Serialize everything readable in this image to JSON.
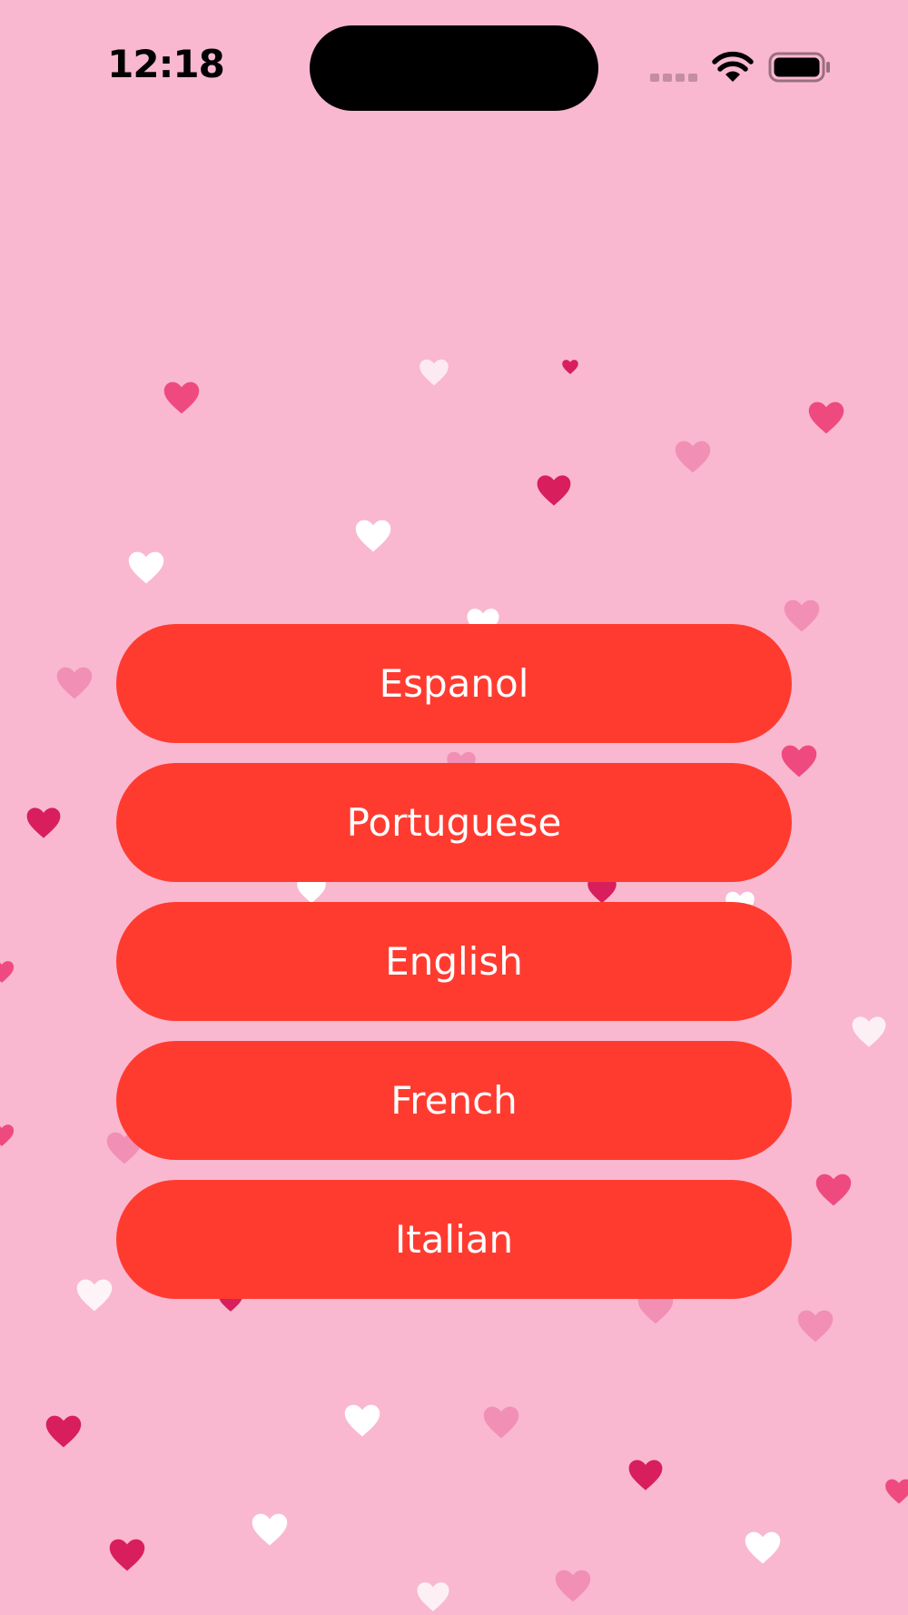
{
  "status_bar": {
    "time": "12:18",
    "colors": {
      "text": "#000000",
      "signal_inactive": "#c48ea1"
    }
  },
  "background_color": "#f9b8d0",
  "button_color": "#ff3b30",
  "button_text_color": "#ffffff",
  "heart_colors": {
    "white": "#ffffff",
    "light_pink": "#f28fb5",
    "pink": "#ef4a80",
    "magenta": "#d81e5c"
  },
  "language_buttons": [
    {
      "label": "Espanol"
    },
    {
      "label": "Portuguese"
    },
    {
      "label": "English"
    },
    {
      "label": "French"
    },
    {
      "label": "Italian"
    }
  ]
}
